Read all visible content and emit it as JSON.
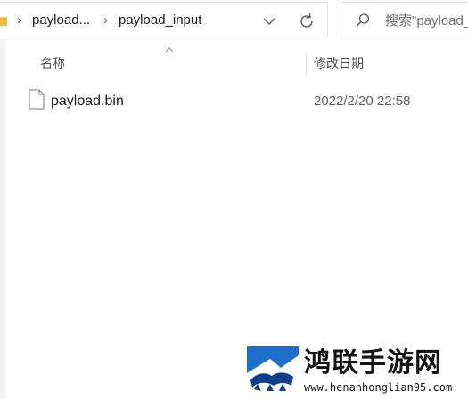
{
  "address_bar": {
    "breadcrumbs": [
      "payload...",
      "payload_input"
    ],
    "separator": "›"
  },
  "search": {
    "placeholder": "搜索\"payload_input\""
  },
  "columns": {
    "name": "名称",
    "date_modified": "修改日期"
  },
  "files": [
    {
      "name": "payload.bin",
      "date_modified": "2022/2/20 22:58",
      "icon": "file-icon"
    }
  ],
  "watermark": {
    "site_name": "鸿联手游网",
    "url": "www.henanhonglian95.com"
  },
  "colors": {
    "folder": "#f5c13a",
    "logo_blue": "#1d6fc9",
    "logo_dark": "#0f3e8a"
  }
}
